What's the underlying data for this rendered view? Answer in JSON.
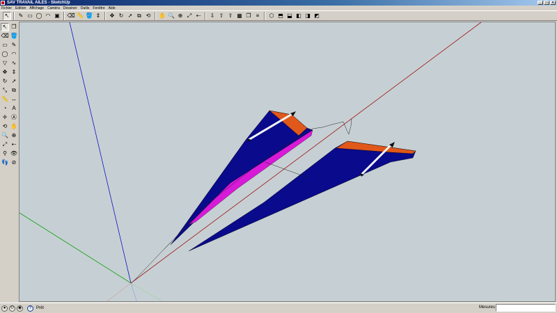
{
  "window": {
    "title": "SAV TRAVAIL AILES - SketchUp"
  },
  "menu": {
    "items": [
      "Fichier",
      "Edition",
      "Affichage",
      "Caméra",
      "Dessiner",
      "Outils",
      "Fenêtre",
      "Aide"
    ]
  },
  "toolbar": {
    "items": [
      {
        "icon": "select-arrow-icon",
        "glyph": "↖"
      },
      {
        "icon": "pencil-icon",
        "glyph": "✎"
      },
      {
        "icon": "rectangle-icon",
        "glyph": "▭"
      },
      {
        "icon": "circle-icon",
        "glyph": "◯"
      },
      {
        "icon": "arc-icon",
        "glyph": "◠"
      },
      {
        "icon": "make-component-icon",
        "glyph": "▣"
      },
      {
        "icon": "eraser-icon",
        "glyph": "⌫"
      },
      {
        "icon": "tape-measure-icon",
        "glyph": "📏"
      },
      {
        "icon": "paint-bucket-icon",
        "glyph": "🪣"
      },
      {
        "icon": "push-pull-icon",
        "glyph": "⇕"
      },
      {
        "icon": "move-icon",
        "glyph": "✥"
      },
      {
        "icon": "rotate-icon",
        "glyph": "↻"
      },
      {
        "icon": "follow-me-icon",
        "glyph": "➚"
      },
      {
        "icon": "offset-icon",
        "glyph": "⧉"
      },
      {
        "icon": "orbit-icon",
        "glyph": "⟲"
      },
      {
        "icon": "pan-icon",
        "glyph": "✋"
      },
      {
        "icon": "zoom-icon",
        "glyph": "🔍"
      },
      {
        "icon": "zoom-window-icon",
        "glyph": "⊕"
      },
      {
        "icon": "zoom-extents-icon",
        "glyph": "⤢"
      },
      {
        "icon": "previous-view-icon",
        "glyph": "⇠"
      },
      {
        "icon": "get-models-icon",
        "glyph": "⇩"
      },
      {
        "icon": "share-model-icon",
        "glyph": "⇧"
      },
      {
        "icon": "share-component-icon",
        "glyph": "⇪"
      },
      {
        "icon": "get-photo-texture-icon",
        "glyph": "▦"
      },
      {
        "icon": "component-browser-icon",
        "glyph": "❐"
      },
      {
        "icon": "layer-icon",
        "glyph": "≡"
      },
      {
        "icon": "iso-view-icon",
        "glyph": "⬡"
      },
      {
        "icon": "top-view-icon",
        "glyph": "⬒"
      },
      {
        "icon": "front-view-icon",
        "glyph": "⬓"
      },
      {
        "icon": "right-view-icon",
        "glyph": "◧"
      },
      {
        "icon": "back-view-icon",
        "glyph": "◨"
      },
      {
        "icon": "left-view-icon",
        "glyph": "◩"
      }
    ]
  },
  "lefttools": {
    "items": [
      "select-icon",
      "make-component-icon",
      "eraser-icon",
      "paint-bucket-icon",
      "rectangle-icon",
      "line-icon",
      "circle-icon",
      "arc-icon",
      "polygon-icon",
      "freehand-icon",
      "move-icon",
      "push-pull-icon",
      "rotate-icon",
      "follow-me-icon",
      "scale-icon",
      "offset-icon",
      "tape-measure-icon",
      "dimension-icon",
      "protractor-icon",
      "text-icon",
      "axes-icon",
      "3d-text-icon",
      "orbit-icon",
      "pan-icon",
      "zoom-icon",
      "zoom-window-icon",
      "zoom-extents-icon",
      "previous-icon",
      "position-camera-icon",
      "look-around-icon",
      "walk-icon",
      "section-plane-icon"
    ],
    "glyphs": [
      "↖",
      "❐",
      "⌫",
      "🪣",
      "▭",
      "✎",
      "◯",
      "◠",
      "▽",
      "∿",
      "✥",
      "⇕",
      "↻",
      "➚",
      "⤡",
      "⧉",
      "📏",
      "↔",
      "◔",
      "A",
      "✛",
      "Ⓐ",
      "⟲",
      "✋",
      "🔍",
      "⊕",
      "⤢",
      "⇠",
      "⚲",
      "👁",
      "👣",
      "⊘"
    ]
  },
  "status": {
    "text": "Prêt",
    "measure_label": "Mesures",
    "measure_value": ""
  },
  "colors": {
    "viewport_bg": "#c6d0d4",
    "wing_blue": "#0a0a8c",
    "wing_orange": "#e0581a",
    "wing_magenta": "#d81ad8",
    "axis_red": "#a01010",
    "axis_green": "#10a010",
    "axis_blue": "#1010c0"
  }
}
